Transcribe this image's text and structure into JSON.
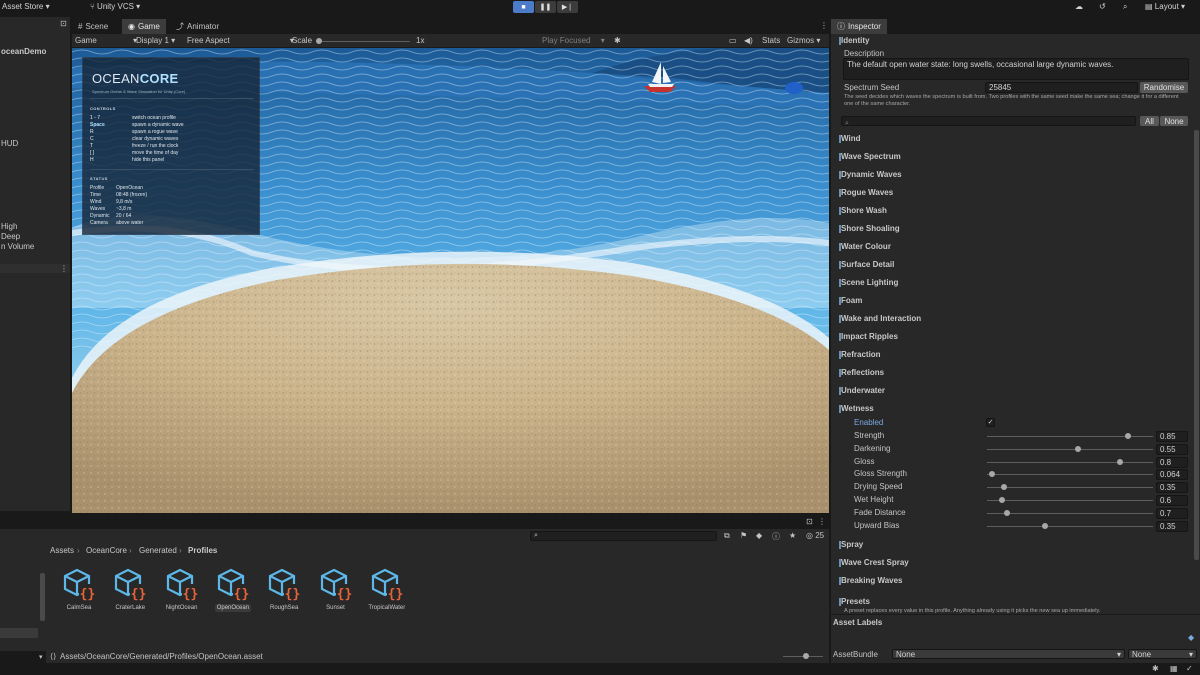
{
  "toolbar": {
    "asset_store": "Asset Store ▾",
    "vcs": "Unity VCS ▾",
    "layout": "Layout ▾"
  },
  "hierarchy": {
    "items": [
      "oceanDemo",
      "HUD",
      "High",
      "Deep",
      "n Volume"
    ]
  },
  "game_tabs": {
    "scene": "Scene",
    "game": "Game",
    "animator": "Animator"
  },
  "game_bar": {
    "mode": "Game",
    "display": "Display 1",
    "aspect": "Free Aspect",
    "scale_label": "Scale",
    "scale_value": "1x",
    "play_focused": "Play Focused",
    "stats": "Stats",
    "gizmos": "Gizmos"
  },
  "hud": {
    "logo_a": "OCEAN",
    "logo_b": "CORE",
    "tagline": "Spectrum Ocean & Wave Simulation for Unity (Core)",
    "controls_title": "CONTROLS",
    "controls": [
      {
        "key": "1 - 7",
        "desc": "switch ocean profile"
      },
      {
        "key": "Space",
        "desc": "spawn a dynamic wave"
      },
      {
        "key": "R",
        "desc": "spawn a rogue wave"
      },
      {
        "key": "C",
        "desc": "clear dynamic waves"
      },
      {
        "key": "T",
        "desc": "freeze / run the clock"
      },
      {
        "key": "[ ]",
        "desc": "move the time of day"
      },
      {
        "key": "H",
        "desc": "hide this panel"
      }
    ],
    "status_title": "STATUS",
    "status": [
      {
        "key": "Profile",
        "val": "OpenOcean"
      },
      {
        "key": "Time",
        "val": "08:48  (frozen)"
      },
      {
        "key": "Wind",
        "val": "9,8 m/s"
      },
      {
        "key": "Waves",
        "val": "~3,8 m"
      },
      {
        "key": "Dynamic",
        "val": "20 / 64"
      },
      {
        "key": "Camera",
        "val": "above water"
      }
    ]
  },
  "project": {
    "breadcrumb": [
      "Assets",
      "OceanCore",
      "Generated",
      "Profiles"
    ],
    "count": "25",
    "assets": [
      "CalmSea",
      "CraterLake",
      "NightOcean",
      "OpenOcean",
      "RoughSea",
      "Sunset",
      "TropicalWater"
    ],
    "selected_index": 3,
    "status_path": "Assets/OceanCore/Generated/Profiles/OpenOcean.asset"
  },
  "inspector": {
    "tab": "Inspector",
    "identity_title": "Identity",
    "description_label": "Description",
    "description_value": "The default open water state: long swells, occasional large dynamic waves.",
    "seed_label": "Spectrum Seed",
    "seed_value": "25845",
    "randomise": "Randomise",
    "seed_help": "The seed decides which waves the spectrum is built from. Two profiles with the same seed make the same sea; change it for a different one of the same character.",
    "all": "All",
    "none": "None",
    "sections": [
      "Wind",
      "Wave Spectrum",
      "Dynamic Waves",
      "Rogue Waves",
      "Shore Wash",
      "Shore Shoaling",
      "Water Colour",
      "Surface Detail",
      "Scene Lighting",
      "Foam",
      "Wake and Interaction",
      "Impact Ripples",
      "Refraction",
      "Reflections",
      "Underwater",
      "Wetness"
    ],
    "wetness": {
      "enabled_label": "Enabled",
      "params": [
        {
          "label": "Strength",
          "value": "0.85",
          "frac": 0.85
        },
        {
          "label": "Darkening",
          "value": "0.55",
          "frac": 0.55
        },
        {
          "label": "Gloss",
          "value": "0.8",
          "frac": 0.8
        },
        {
          "label": "Gloss Strength",
          "value": "0.064",
          "frac": 0.03
        },
        {
          "label": "Drying Speed",
          "value": "0.35",
          "frac": 0.1
        },
        {
          "label": "Wet Height",
          "value": "0.6",
          "frac": 0.09
        },
        {
          "label": "Fade Distance",
          "value": "0.7",
          "frac": 0.12
        },
        {
          "label": "Upward Bias",
          "value": "0.35",
          "frac": 0.35
        }
      ]
    },
    "sections_after": [
      "Spray",
      "Wave Crest Spray",
      "Breaking Waves"
    ],
    "presets_title": "Presets",
    "presets_help": "A preset replaces every value in this profile. Anything already using it picks the new sea up immediately."
  },
  "asset_labels": {
    "title": "Asset Labels",
    "bundle_label": "AssetBundle",
    "bundle_value": "None",
    "variant_value": "None"
  },
  "colors": {
    "accent": "#4b7bc9",
    "panel": "#282828",
    "bg": "#191919",
    "asset_icon": "#5db8e8",
    "asset_braces": "#e8643a"
  }
}
